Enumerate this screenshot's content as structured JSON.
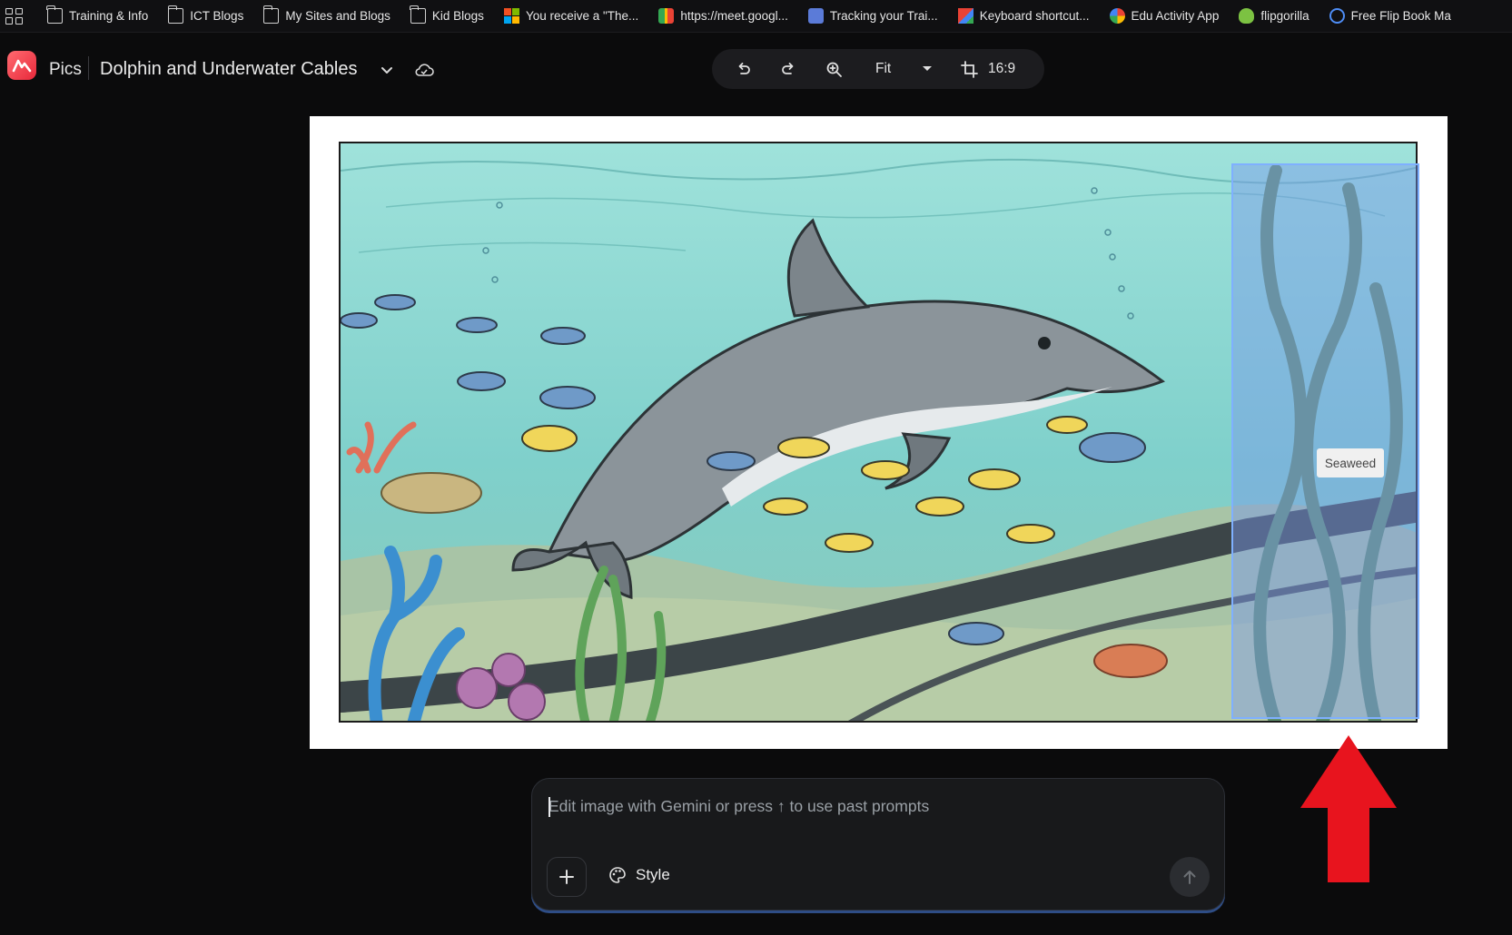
{
  "bookmarks": [
    {
      "label": "Training & Info",
      "icon": "folder-icon"
    },
    {
      "label": "ICT Blogs",
      "icon": "folder-icon"
    },
    {
      "label": "My Sites and Blogs",
      "icon": "folder-icon"
    },
    {
      "label": "Kid Blogs",
      "icon": "folder-icon"
    },
    {
      "label": "You receive a \"The...",
      "icon": "microsoft-icon"
    },
    {
      "label": "https://meet.googl...",
      "icon": "meet-icon"
    },
    {
      "label": "Tracking your Trai...",
      "icon": "tracking-icon"
    },
    {
      "label": "Keyboard shortcut...",
      "icon": "keyboard-icon"
    },
    {
      "label": "Edu Activity App",
      "icon": "google-icon"
    },
    {
      "label": "flipgorilla",
      "icon": "flipgorilla-icon"
    },
    {
      "label": "Free Flip Book Ma",
      "icon": "flipbook-icon"
    }
  ],
  "app": {
    "name": "Pics",
    "document_title": "Dolphin and Underwater Cables"
  },
  "toolbar": {
    "zoom_mode": "Fit",
    "aspect_ratio": "16:9"
  },
  "canvas": {
    "selection_label": "Seaweed"
  },
  "prompt": {
    "placeholder": "Edit image with Gemini or press ↑ to use past prompts",
    "style_label": "Style"
  },
  "colors": {
    "accent_red": "#e8293b",
    "selection_blue": "#7fb0ff",
    "arrow_red": "#e8141e",
    "water": "#7cd0cb"
  }
}
